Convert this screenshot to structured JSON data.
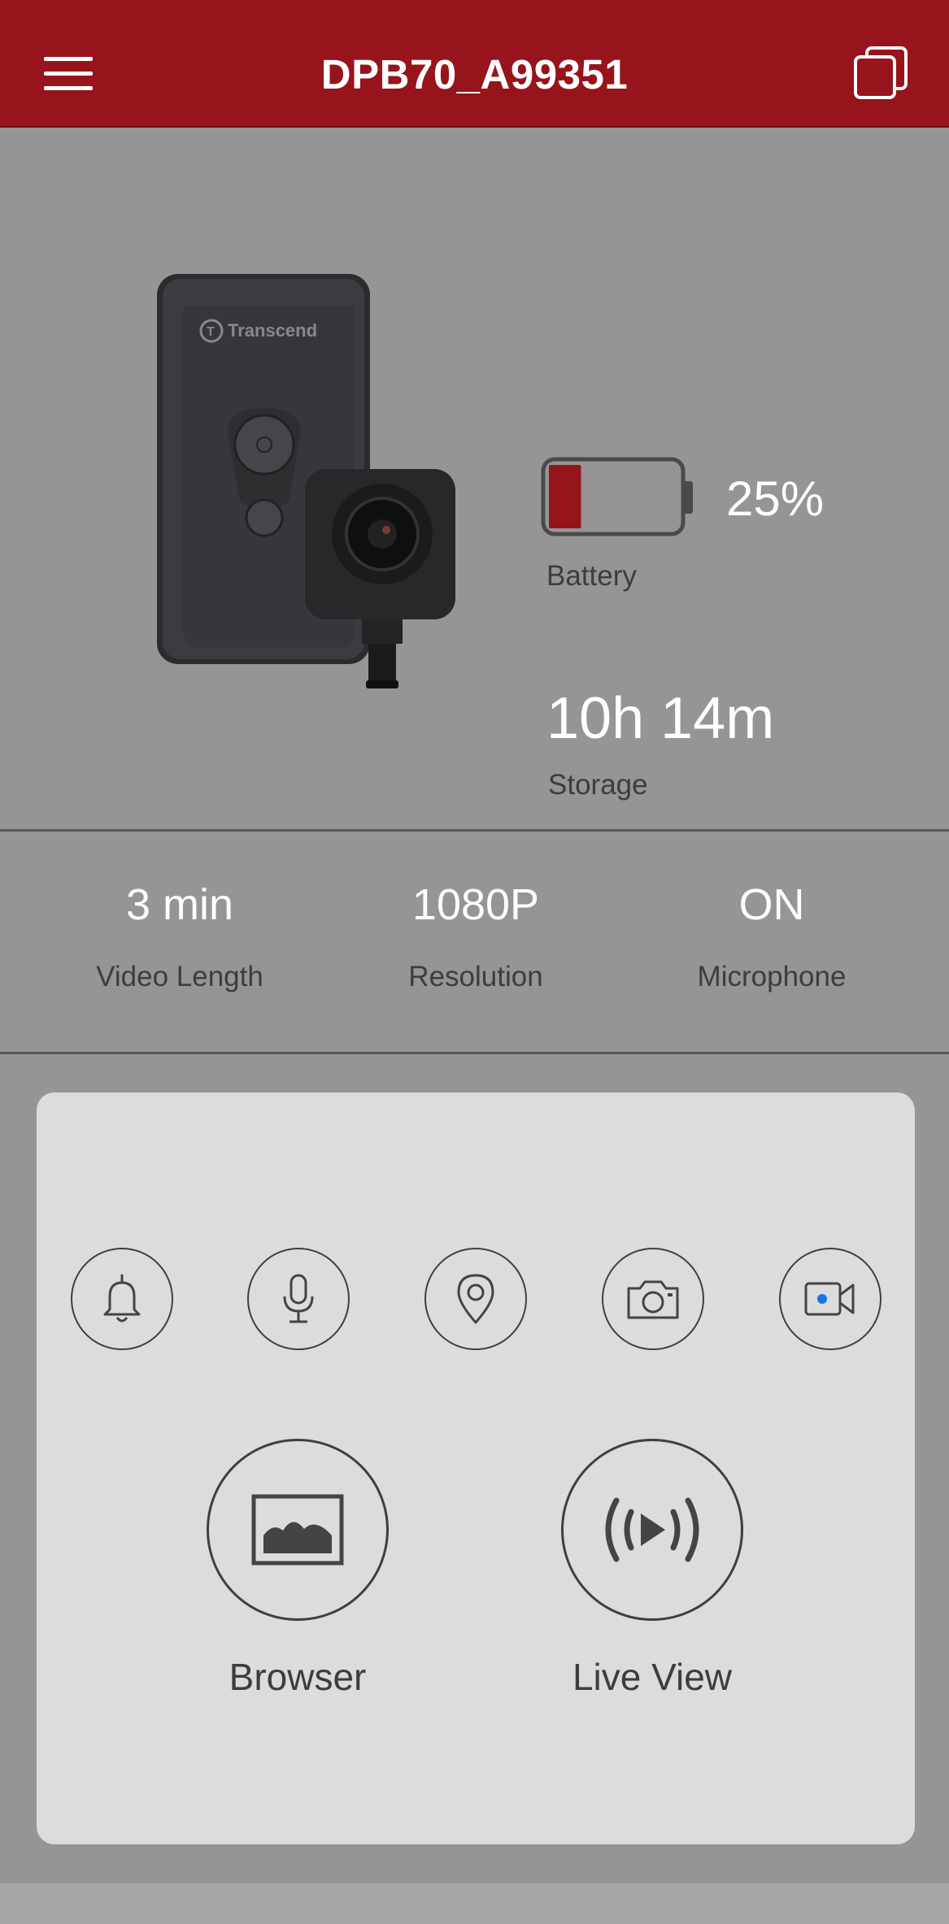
{
  "header": {
    "title": "DPB70_A99351",
    "menu_icon": "hamburger-menu-icon",
    "device_list_icon": "stacked-windows-icon",
    "background_color": "#97141c"
  },
  "device": {
    "image_icon": "body-camera-product-image",
    "brand_text": "Transcend"
  },
  "battery": {
    "percent_text": "25%",
    "level": 0.25,
    "label": "Battery",
    "fill_color": "#97141c"
  },
  "storage": {
    "value": "10h 14m",
    "label": "Storage"
  },
  "stats": [
    {
      "value": "3 min",
      "label": "Video Length"
    },
    {
      "value": "1080P",
      "label": "Resolution"
    },
    {
      "value": "ON",
      "label": "Microphone"
    }
  ],
  "quick_actions": [
    {
      "icon": "bell-icon"
    },
    {
      "icon": "microphone-icon"
    },
    {
      "icon": "location-pin-icon"
    },
    {
      "icon": "camera-icon"
    },
    {
      "icon": "video-record-icon",
      "dot_color": "#1a73e8"
    }
  ],
  "main_actions": [
    {
      "icon": "image-gallery-icon",
      "label": "Browser"
    },
    {
      "icon": "live-stream-icon",
      "label": "Live View"
    }
  ]
}
